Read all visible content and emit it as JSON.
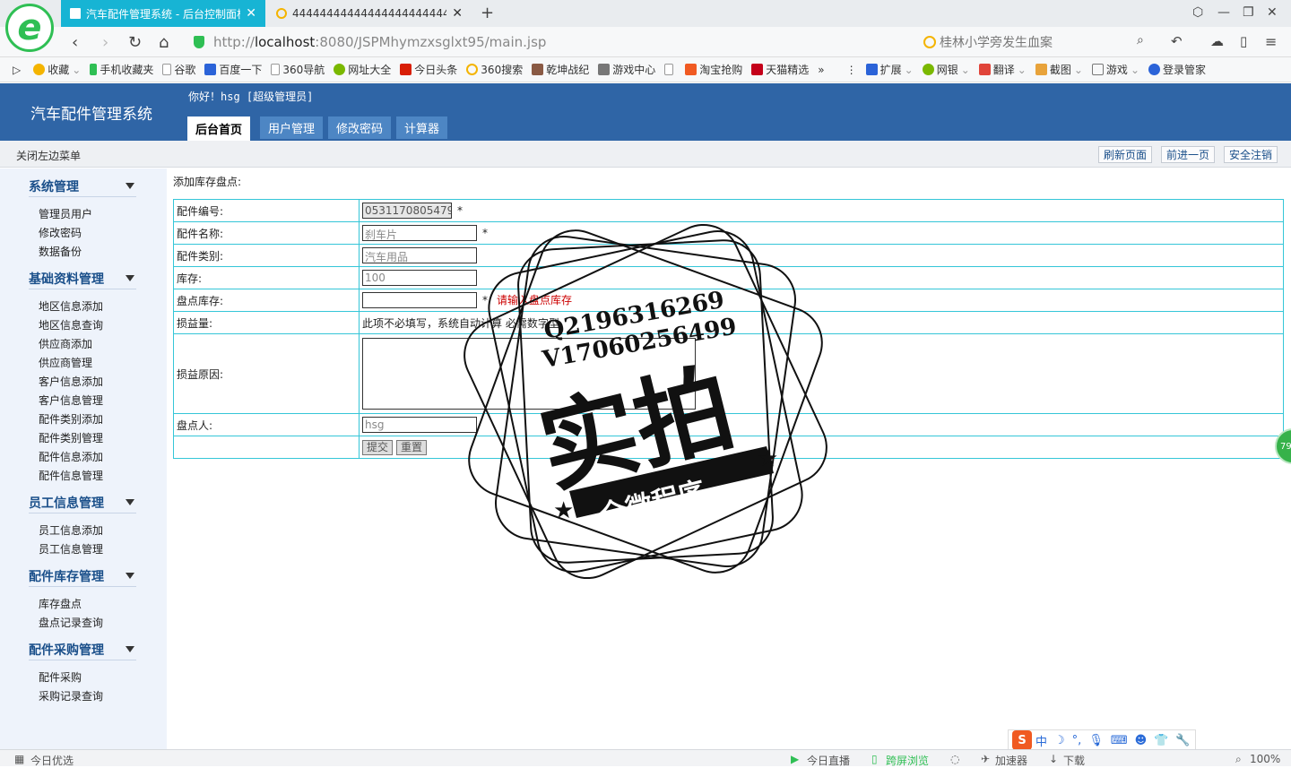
{
  "browser": {
    "tabs": [
      {
        "label": "汽车配件管理系统 - 后台控制面板",
        "active": true
      },
      {
        "label": "444444444444444444444444",
        "active": false
      }
    ],
    "url_prefix": "http://",
    "url_host": "localhost",
    "url_rest": ":8080/JSPMhymzxsglxt95/main.jsp",
    "search_placeholder": "桂林小学旁发生血案",
    "bookmarks": [
      "收藏",
      "手机收藏夹",
      "谷歌",
      "百度一下",
      "360导航",
      "网址大全",
      "今日头条",
      "360搜索",
      "乾坤战纪",
      "游戏中心",
      "",
      "淘宝抢购",
      "天猫精选",
      "»",
      "扩展",
      "网银",
      "翻译",
      "截图",
      "游戏",
      "登录管家"
    ]
  },
  "header": {
    "app_title": "汽车配件管理系统",
    "greeting": "你好！hsg [超级管理员]",
    "tabs": [
      "后台首页",
      "用户管理",
      "修改密码",
      "计算器"
    ]
  },
  "subbar": {
    "close_menu": "关闭左边菜单",
    "refresh": "刷新页面",
    "forward": "前进一页",
    "logout": "安全注销"
  },
  "sidebar": {
    "groups": [
      {
        "title": "系统管理",
        "items": [
          "管理员用户",
          "修改密码",
          "数据备份"
        ]
      },
      {
        "title": "基础资料管理",
        "items": [
          "地区信息添加",
          "地区信息查询",
          "供应商添加",
          "供应商管理",
          "客户信息添加",
          "客户信息管理",
          "配件类别添加",
          "配件类别管理",
          "配件信息添加",
          "配件信息管理"
        ]
      },
      {
        "title": "员工信息管理",
        "items": [
          "员工信息添加",
          "员工信息管理"
        ]
      },
      {
        "title": "配件库存管理",
        "items": [
          "库存盘点",
          "盘点记录查询"
        ]
      },
      {
        "title": "配件采购管理",
        "items": [
          "配件采购",
          "采购记录查询"
        ]
      }
    ]
  },
  "form": {
    "title": "添加库存盘点:",
    "fields": {
      "part_no": {
        "label": "配件编号:",
        "value": "05311708054796"
      },
      "part_name": {
        "label": "配件名称:",
        "value": "刹车片"
      },
      "category": {
        "label": "配件类别:",
        "value": "汽车用品"
      },
      "stock": {
        "label": "库存:",
        "value": "100"
      },
      "counted": {
        "label": "盘点库存:",
        "value": "",
        "error": "请输入盘点库存"
      },
      "diff": {
        "label": "损益量:",
        "note": "此项不必填写，系统自动计算 必需数字型"
      },
      "reason": {
        "label": "损益原因:"
      },
      "counter": {
        "label": "盘点人:",
        "value": "hsg"
      }
    },
    "required_mark": "*",
    "submit": "提交",
    "reset": "重置"
  },
  "stamp": {
    "line1": "Q2196316269",
    "line2": "V17060256499",
    "main": "实拍",
    "banner": "全微程序"
  },
  "statusbar": {
    "left": "今日优选",
    "live": "今日直播",
    "cross": "跨屏浏览",
    "accel": "加速器",
    "download": "下载",
    "zoom": "100%"
  },
  "ime": {
    "label": "中"
  },
  "bubble": "79"
}
